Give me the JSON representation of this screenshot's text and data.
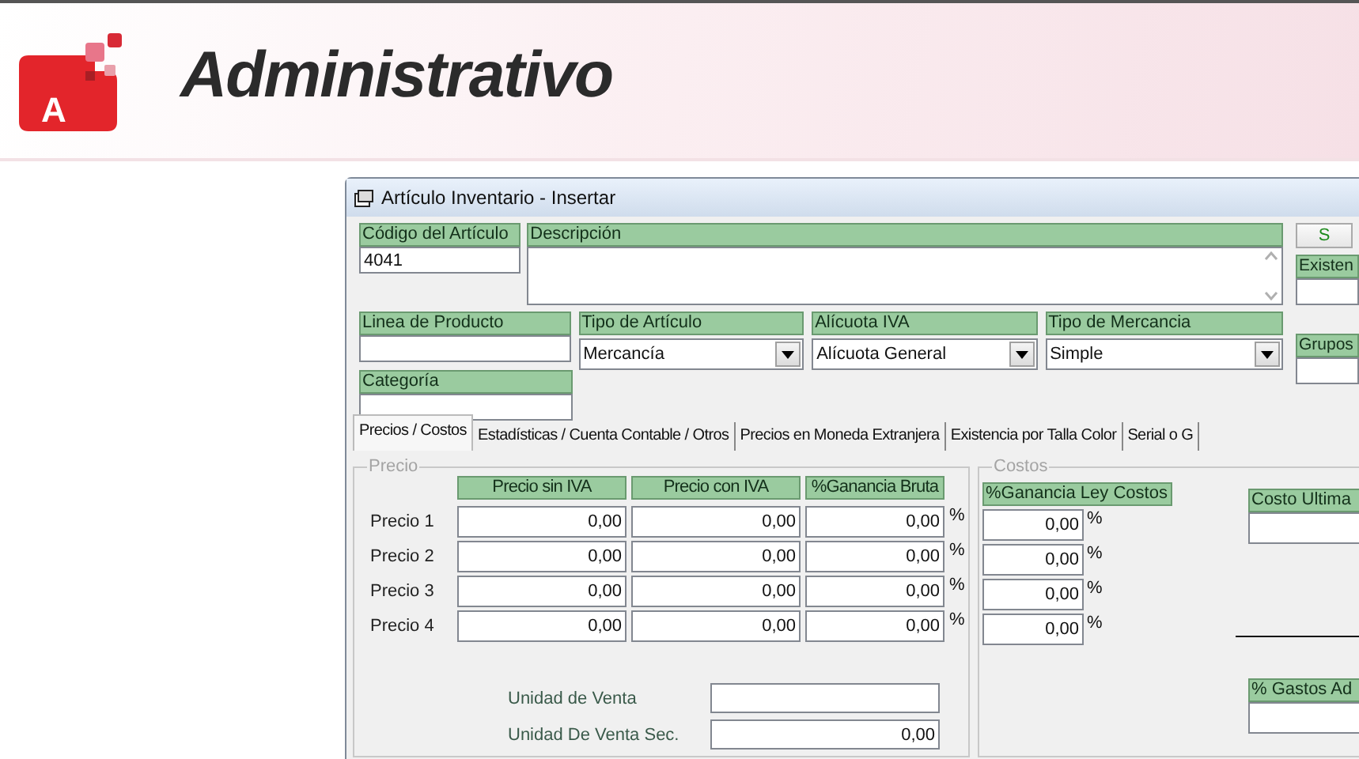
{
  "header": {
    "logo_letter": "A",
    "title": "Administrativo"
  },
  "window": {
    "title": "Artículo Inventario - Insertar"
  },
  "codigo": {
    "label": "Código del Artículo",
    "value": "4041"
  },
  "descripcion": {
    "label": "Descripción"
  },
  "linea": {
    "label": "Linea de Producto"
  },
  "tipo_articulo": {
    "label": "Tipo de Artículo",
    "value": "Mercancía"
  },
  "alicuota": {
    "label": "Alícuota IVA",
    "value": "Alícuota General"
  },
  "tipo_mercancia": {
    "label": "Tipo de Mercancia",
    "value": "Simple"
  },
  "categoria": {
    "label": "Categoría"
  },
  "side": {
    "button": "S",
    "existencia": "Existen",
    "grupos": "Grupos"
  },
  "tabs": [
    {
      "label": "Precios / Costos",
      "selected": true
    },
    {
      "label": "Estadísticas / Cuenta Contable / Otros",
      "selected": false
    },
    {
      "label": "Precios en Moneda Extranjera",
      "selected": false
    },
    {
      "label": "Existencia por Talla Color",
      "selected": false
    },
    {
      "label": "Serial o G",
      "selected": false
    }
  ],
  "precio": {
    "legend": "Precio",
    "columns": [
      "Precio sin IVA",
      "Precio con IVA",
      "%Ganancia Bruta"
    ],
    "rows": [
      {
        "label": "Precio 1",
        "values": [
          "0,00",
          "0,00",
          "0,00"
        ],
        "unit": "%"
      },
      {
        "label": "Precio 2",
        "values": [
          "0,00",
          "0,00",
          "0,00"
        ],
        "unit": "%"
      },
      {
        "label": "Precio 3",
        "values": [
          "0,00",
          "0,00",
          "0,00"
        ],
        "unit": "%"
      },
      {
        "label": "Precio 4",
        "values": [
          "0,00",
          "0,00",
          "0,00"
        ],
        "unit": "%"
      }
    ],
    "unidad_venta": {
      "label": "Unidad de Venta"
    },
    "unidad_venta_sec": {
      "label": "Unidad De Venta Sec.",
      "value": "0,00"
    }
  },
  "costos": {
    "legend": "Costos",
    "column": "%Ganancia Ley Costos",
    "rows": [
      {
        "value": "0,00",
        "unit": "%"
      },
      {
        "value": "0,00",
        "unit": "%"
      },
      {
        "value": "0,00",
        "unit": "%"
      },
      {
        "value": "0,00",
        "unit": "%"
      }
    ],
    "costo_ultima": {
      "label": "Costo Ultima"
    },
    "gastos": {
      "label": "% Gastos Ad"
    }
  }
}
